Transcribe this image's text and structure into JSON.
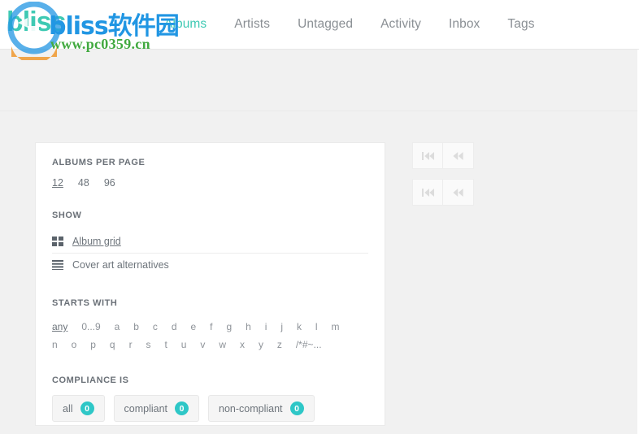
{
  "brand": {
    "name": "bliss",
    "logo_icon": "bliss-logo-icon"
  },
  "watermark": {
    "text_cn": "bliss软件园",
    "url": "www.pc0359.cn",
    "blue": "#2196e3",
    "green": "#41a93f",
    "orange": "#f0982d"
  },
  "nav": {
    "items": [
      {
        "label": "Albums",
        "active": true
      },
      {
        "label": "Artists",
        "active": false
      },
      {
        "label": "Untagged",
        "active": false
      },
      {
        "label": "Activity",
        "active": false
      },
      {
        "label": "Inbox",
        "active": false
      },
      {
        "label": "Tags",
        "active": false
      }
    ],
    "active_color": "#3ec9b3",
    "inactive_color": "#8a8f94"
  },
  "filters": {
    "albums_per_page": {
      "title": "ALBUMS PER PAGE",
      "options": [
        {
          "label": "12",
          "active": true
        },
        {
          "label": "48",
          "active": false
        },
        {
          "label": "96",
          "active": false
        }
      ]
    },
    "show": {
      "title": "SHOW",
      "options": [
        {
          "label": "Album grid",
          "icon": "grid-icon",
          "active": true
        },
        {
          "label": "Cover art alternatives",
          "icon": "list-icon",
          "active": false
        }
      ]
    },
    "starts_with": {
      "title": "STARTS WITH",
      "options": [
        {
          "label": "any",
          "active": true
        },
        {
          "label": "0...9",
          "active": false
        },
        {
          "label": "a",
          "active": false
        },
        {
          "label": "b",
          "active": false
        },
        {
          "label": "c",
          "active": false
        },
        {
          "label": "d",
          "active": false
        },
        {
          "label": "e",
          "active": false
        },
        {
          "label": "f",
          "active": false
        },
        {
          "label": "g",
          "active": false
        },
        {
          "label": "h",
          "active": false
        },
        {
          "label": "i",
          "active": false
        },
        {
          "label": "j",
          "active": false
        },
        {
          "label": "k",
          "active": false
        },
        {
          "label": "l",
          "active": false
        },
        {
          "label": "m",
          "active": false
        },
        {
          "label": "n",
          "active": false
        },
        {
          "label": "o",
          "active": false
        },
        {
          "label": "p",
          "active": false
        },
        {
          "label": "q",
          "active": false
        },
        {
          "label": "r",
          "active": false
        },
        {
          "label": "s",
          "active": false
        },
        {
          "label": "t",
          "active": false
        },
        {
          "label": "u",
          "active": false
        },
        {
          "label": "v",
          "active": false
        },
        {
          "label": "w",
          "active": false
        },
        {
          "label": "x",
          "active": false
        },
        {
          "label": "y",
          "active": false
        },
        {
          "label": "z",
          "active": false
        },
        {
          "label": "/*#~...",
          "active": false
        }
      ]
    },
    "compliance": {
      "title": "COMPLIANCE IS",
      "badge_color": "#2ec7c7",
      "options": [
        {
          "label": "all",
          "count": "0"
        },
        {
          "label": "compliant",
          "count": "0"
        },
        {
          "label": "non-compliant",
          "count": "0"
        }
      ]
    }
  },
  "pagination": {
    "top": [
      {
        "icon": "skip-to-first-icon",
        "disabled": true
      },
      {
        "icon": "previous-page-icon",
        "disabled": true
      }
    ],
    "bottom": [
      {
        "icon": "skip-to-first-icon",
        "disabled": true
      },
      {
        "icon": "previous-page-icon",
        "disabled": true
      }
    ]
  }
}
